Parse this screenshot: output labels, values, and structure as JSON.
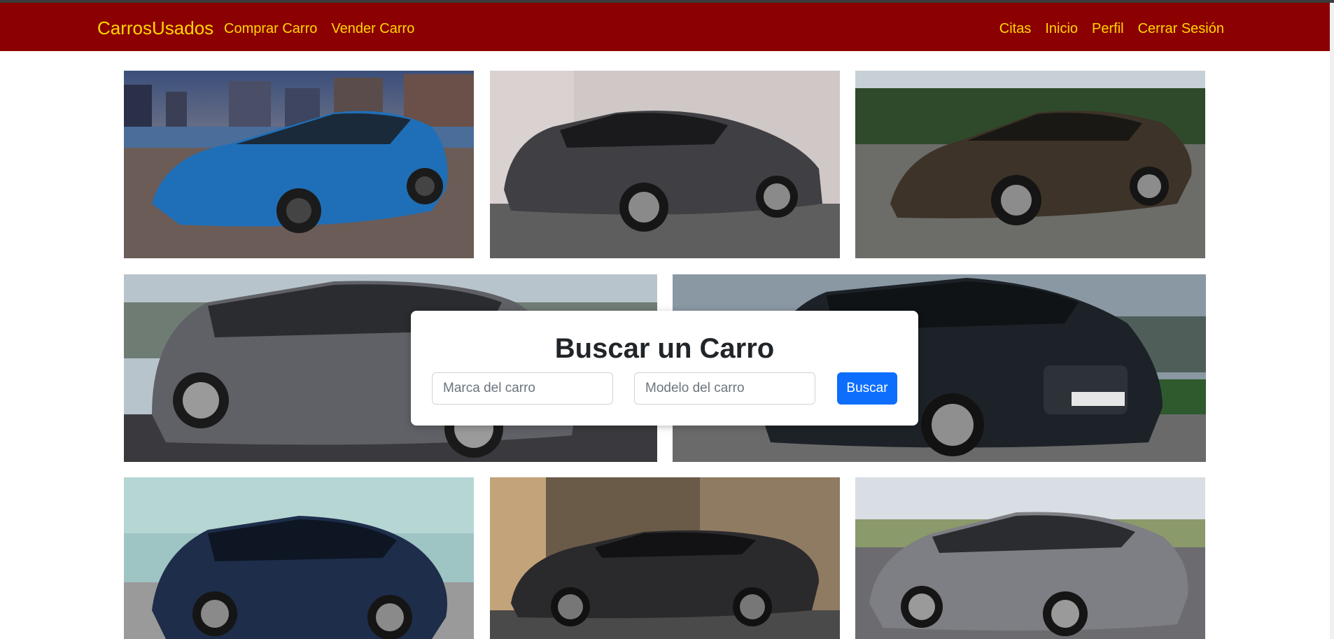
{
  "navbar": {
    "brand": "CarrosUsados",
    "left_links": [
      "Comprar Carro",
      "Vender Carro"
    ],
    "right_links": [
      "Citas",
      "Inicio",
      "Perfil",
      "Cerrar Sesión"
    ],
    "background": "#8b0000",
    "link_color": "#ffd700"
  },
  "gallery": {
    "row1": [
      {
        "name": "blue-wagon-photo",
        "body": "#1f6fb8"
      },
      {
        "name": "dark-grey-wagon-photo",
        "body": "#3f3f44"
      },
      {
        "name": "brown-sport-wagon-photo",
        "body": "#3d3328"
      }
    ],
    "row2": [
      {
        "name": "grey-estate-photo",
        "body": "#5f6166"
      },
      {
        "name": "black-audi-wagon-photo",
        "body": "#1c2227"
      }
    ],
    "row3": [
      {
        "name": "navy-mercedes-wagon-photo",
        "body": "#1d2d4a"
      },
      {
        "name": "black-volvo-wagon-photo",
        "body": "#2a2a2c"
      },
      {
        "name": "grey-bmw-gt-photo",
        "body": "#7d7f84"
      }
    ]
  },
  "search": {
    "title": "Buscar un Carro",
    "brand_placeholder": "Marca del carro",
    "model_placeholder": "Modelo del carro",
    "button_label": "Buscar",
    "button_color": "#0d6efd"
  }
}
